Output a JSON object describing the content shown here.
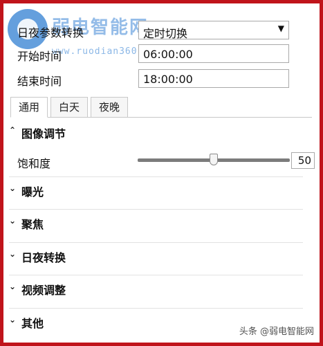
{
  "watermark": {
    "title": "弱电智能网",
    "url": "www.ruodian360.com",
    "footer": "头条 @弱电智能网"
  },
  "mode": {
    "label": "日夜参数转换",
    "value": "定时切换"
  },
  "start": {
    "label": "开始时间",
    "value": "06:00:00"
  },
  "end": {
    "label": "结束时间",
    "value": "18:00:00"
  },
  "tabs": [
    {
      "label": "通用",
      "active": true
    },
    {
      "label": "白天",
      "active": false
    },
    {
      "label": "夜晚",
      "active": false
    }
  ],
  "sections": {
    "image": "图像调节",
    "exposure": "曝光",
    "focus": "聚焦",
    "daynight": "日夜转换",
    "video": "视频调整",
    "other": "其他"
  },
  "saturation": {
    "label": "饱和度",
    "value": "50",
    "level": 0.5
  },
  "icons": {
    "expanded": "chevron-up-icon",
    "collapsed": "chevron-down-icon",
    "dropdown": "triangle-down-icon"
  }
}
